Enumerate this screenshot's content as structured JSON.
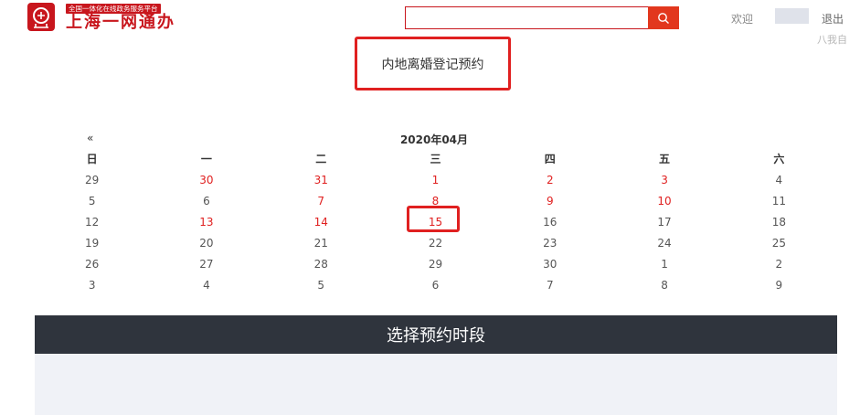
{
  "header": {
    "logo_tagline": "全国一体化在线政务服务平台",
    "logo_name": "上海一网通办",
    "search": {
      "value": "",
      "placeholder": ""
    },
    "welcome_text": "欢迎",
    "logout_label": "退出",
    "ghost_text": "八我自"
  },
  "page_title": "内地离婚登记预约",
  "calendar": {
    "prev_label": "«",
    "month_label": "2020年04月",
    "weekdays": [
      "日",
      "一",
      "二",
      "三",
      "四",
      "五",
      "六"
    ],
    "weeks": [
      [
        "29",
        "30",
        "31",
        "1",
        "2",
        "3",
        "4"
      ],
      [
        "5",
        "6",
        "7",
        "8",
        "9",
        "10",
        "11"
      ],
      [
        "12",
        "13",
        "14",
        "15",
        "16",
        "17",
        "18"
      ],
      [
        "19",
        "20",
        "21",
        "22",
        "23",
        "24",
        "25"
      ],
      [
        "26",
        "27",
        "28",
        "29",
        "30",
        "1",
        "2"
      ],
      [
        "3",
        "4",
        "5",
        "6",
        "7",
        "8",
        "9"
      ]
    ],
    "available_days": [
      "30",
      "31",
      "1",
      "2",
      "3",
      "7",
      "8",
      "9",
      "10",
      "13",
      "14",
      "15"
    ],
    "selected_day": "15"
  },
  "time_slot_title": "选择预约时段",
  "colors": {
    "brand_red": "#c8161d",
    "highlight_red": "#e02020",
    "dark_bar": "#2f343d",
    "slot_area_bg": "#f0f2f7"
  },
  "icons": {
    "search": "search-icon",
    "logo": "emblem-logo-icon"
  }
}
